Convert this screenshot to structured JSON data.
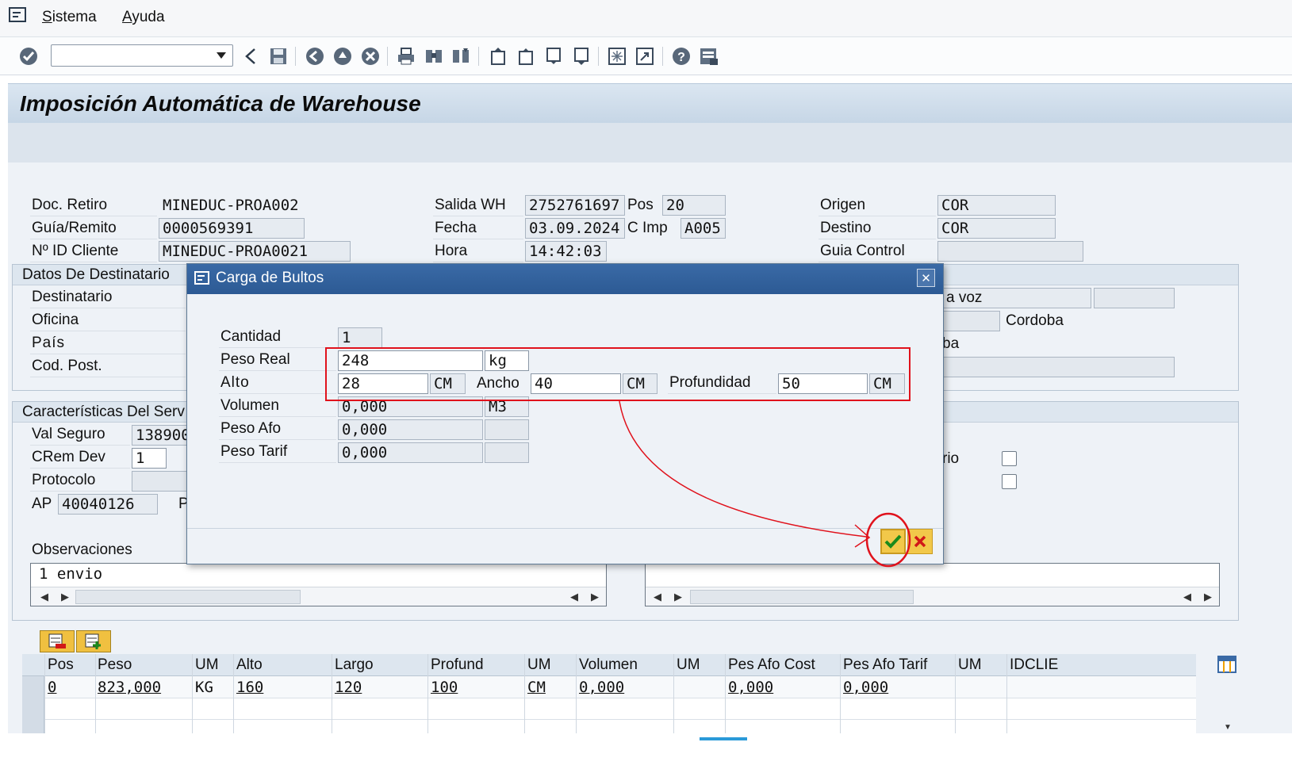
{
  "menu": {
    "items": [
      "Sistema",
      "Ayuda"
    ]
  },
  "toolbar": {
    "command_value": "",
    "icons": [
      "enter-check",
      "back",
      "save",
      "back-nav",
      "exit",
      "cancel",
      "print",
      "find",
      "find-next",
      "first-page",
      "prev-page",
      "next-page",
      "last-page",
      "new-session",
      "shortcut",
      "help",
      "customize-layout"
    ]
  },
  "title": "Imposición Automática de Warehouse",
  "header": {
    "doc_retiro_label": "Doc. Retiro",
    "doc_retiro": "MINEDUC-PROA002",
    "guia_label": "Guía/Remito",
    "guia": "0000569391",
    "id_cliente_label": "Nº ID Cliente",
    "id_cliente": "MINEDUC-PROA0021",
    "salida_label": "Salida WH",
    "salida": "2752761697",
    "pos_label": "Pos",
    "pos": "20",
    "fecha_label": "Fecha",
    "fecha": "03.09.2024",
    "cimp_label": "C Imp",
    "cimp": "A005",
    "hora_label": "Hora",
    "hora": "14:42:03",
    "origen_label": "Origen",
    "origen": "COR",
    "destino_label": "Destino",
    "destino": "COR",
    "guia_control_label": "Guia Control",
    "guia_control": ""
  },
  "destinatario": {
    "group_title": "Datos De Destinatario",
    "destinatario_label": "Destinatario",
    "oficina_label": "Oficina",
    "pais_label": "País",
    "codpost_label": "Cod. Post.",
    "right_partial_1": "a voz",
    "right_partial_2": "Cordoba",
    "right_partial_3": "ba"
  },
  "servicio": {
    "group_title": "Características Del Serv",
    "val_seguro_label": "Val Seguro",
    "val_seguro": "138900",
    "crem_label": "CRem Dev",
    "crem": "1",
    "protocolo_label": "Protocolo",
    "protocolo": "",
    "ap_label": "AP",
    "ap": "40040126",
    "p_partial": "P",
    "rio_partial": "rio"
  },
  "observaciones": {
    "label": "Observaciones",
    "text": "1 envio"
  },
  "table": {
    "columns": [
      "Pos",
      "Peso",
      "UM",
      "Alto",
      "Largo",
      "Profund",
      "UM",
      "Volumen",
      "UM",
      "Pes Afo Cost",
      "Pes Afo Tarif",
      "UM",
      "IDCLIE"
    ],
    "rows": [
      [
        "0",
        "823,000",
        "KG",
        "160",
        "120",
        "100",
        "CM",
        "0,000",
        "",
        "0,000",
        "0,000",
        "",
        ""
      ]
    ]
  },
  "dialog": {
    "title": "Carga de Bultos",
    "cantidad_label": "Cantidad",
    "cantidad": "1",
    "peso_real_label": "Peso Real",
    "peso_real": "248",
    "peso_unit": "kg",
    "alto_label": "Alto",
    "alto": "28",
    "alto_unit": "CM",
    "ancho_label": "Ancho",
    "ancho": "40",
    "ancho_unit": "CM",
    "prof_label": "Profundidad",
    "prof": "50",
    "prof_unit": "CM",
    "volumen_label": "Volumen",
    "volumen": "0,000",
    "volumen_unit": "M3",
    "peso_afo_label": "Peso Afo",
    "peso_afo": "0,000",
    "peso_tarif_label": "Peso Tarif",
    "peso_tarif": "0,000"
  },
  "colors": {
    "annotation_red": "#e0121c",
    "dialog_title_bg": "#2f5e98",
    "confirm_green": "#1b8a1b",
    "cancel_red": "#d11818"
  }
}
